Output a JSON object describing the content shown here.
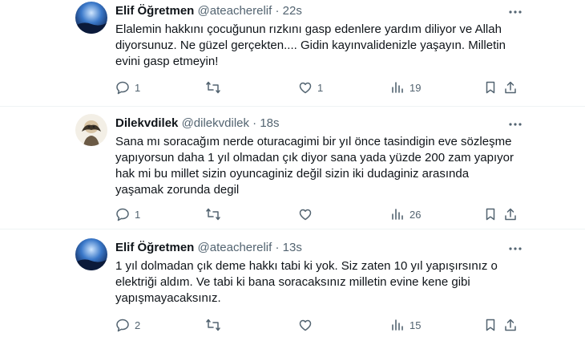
{
  "tweets": [
    {
      "name": "Elif Öğretmen",
      "handle": "@ateacherelif",
      "sep": " · ",
      "time": "22s",
      "avatar_icon": "blue-sky-avatar",
      "text": "Elalemin hakkını çocuğunun rızkını gasp edenlere yardım diliyor ve Allah diyorsunuz. Ne güzel gerçekten.... Gidin kayınvalidenizle yaşayın. Milletin evini gasp etmeyin!",
      "replies": "1",
      "retweets": "",
      "likes": "1",
      "views": "19"
    },
    {
      "name": "Dilekvdilek",
      "handle": "@dilekvdilek",
      "sep": " · ",
      "time": "18s",
      "avatar_icon": "cartoon-avatar",
      "text": "Sana mı soracağım nerde oturacagimi bir yıl önce tasindigin eve sözleşme yapıyorsun daha 1 yıl olmadan çık diyor sana yada yüzde 200 zam yapıyor hak mi bu millet sizin oyuncaginiz değil sizin iki dudaginiz arasında yaşamak zorunda degil",
      "replies": "1",
      "retweets": "",
      "likes": "",
      "views": "26"
    },
    {
      "name": "Elif Öğretmen",
      "handle": "@ateacherelif",
      "sep": " · ",
      "time": "13s",
      "avatar_icon": "blue-sky-avatar",
      "text": "1 yıl dolmadan çık deme hakkı tabi ki yok. Siz zaten 10 yıl yapışırsınız o elektriği aldım. Ve tabi ki bana soracaksınız milletin evine kene gibi yapışmayacaksınız.",
      "replies": "2",
      "retweets": "",
      "likes": "",
      "views": "15"
    }
  ],
  "colors": {
    "text": "#0f1419",
    "muted": "#536471",
    "divider": "#eff3f4"
  }
}
